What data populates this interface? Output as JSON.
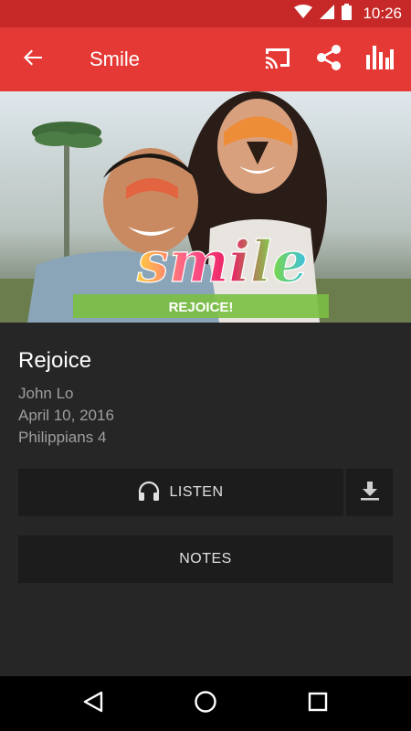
{
  "status_bar": {
    "time": "10:26",
    "icons": [
      "wifi-icon",
      "cell-signal-icon",
      "battery-icon"
    ]
  },
  "app_bar": {
    "title": "Smile",
    "icons": [
      "back-arrow-icon",
      "cast-icon",
      "share-icon",
      "bar-chart-icon"
    ],
    "color": "#e53935"
  },
  "hero": {
    "script_text": "smile",
    "banner_text": "REJOICE!"
  },
  "sermon": {
    "title": "Rejoice",
    "speaker": "John Lo",
    "date": "April 10, 2016",
    "passage": "Philippians 4"
  },
  "actions": {
    "listen_label": "LISTEN",
    "notes_label": "NOTES"
  },
  "nav": {
    "icons": [
      "back-triangle-icon",
      "home-circle-icon",
      "recents-square-icon"
    ]
  }
}
